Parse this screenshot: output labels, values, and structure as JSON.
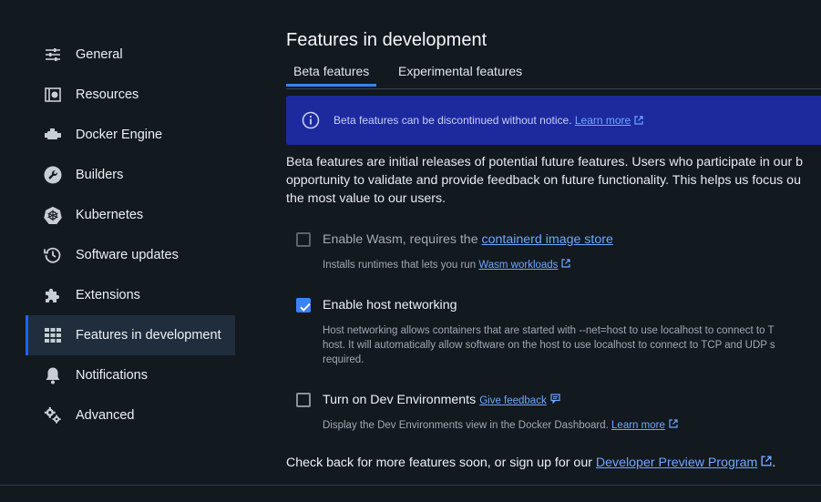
{
  "sidebar": {
    "items": [
      {
        "label": "General",
        "icon": "sliders-icon"
      },
      {
        "label": "Resources",
        "icon": "resources-icon"
      },
      {
        "label": "Docker Engine",
        "icon": "engine-icon"
      },
      {
        "label": "Builders",
        "icon": "wrench-icon"
      },
      {
        "label": "Kubernetes",
        "icon": "kubernetes-icon"
      },
      {
        "label": "Software updates",
        "icon": "history-icon"
      },
      {
        "label": "Extensions",
        "icon": "puzzle-icon"
      },
      {
        "label": "Features in development",
        "icon": "grid-icon",
        "active": true
      },
      {
        "label": "Notifications",
        "icon": "bell-icon"
      },
      {
        "label": "Advanced",
        "icon": "gears-icon"
      }
    ]
  },
  "main": {
    "title": "Features in development",
    "tabs": [
      {
        "label": "Beta features",
        "active": true
      },
      {
        "label": "Experimental features",
        "active": false
      }
    ],
    "banner": {
      "text": "Beta features can be discontinued without notice.",
      "link": "Learn more"
    },
    "description": [
      "Beta features are initial releases of potential future features. Users who participate in our b",
      "opportunity to validate and provide feedback on future functionality. This helps us focus ou",
      "the most value to our users."
    ],
    "features": [
      {
        "label": "Enable Wasm, requires the ",
        "label_link": "containerd image store",
        "checked": false,
        "disabled": true,
        "sub_text": "Installs runtimes that lets you run ",
        "sub_link": "Wasm workloads"
      },
      {
        "label": "Enable host networking",
        "checked": true,
        "disabled": false,
        "sub_lines": [
          "Host networking allows containers that are started with --net=host to use localhost to connect to T",
          "host. It will automatically allow software on the host to use localhost to connect to TCP and UDP s",
          "required."
        ]
      },
      {
        "label": "Turn on Dev Environments",
        "label_link": "Give feedback",
        "checked": false,
        "disabled": false,
        "sub_text": "Display the Dev Environments view in the Docker Dashboard. ",
        "sub_link": "Learn more"
      }
    ],
    "footer": {
      "text": "Check back for more features soon, or sign up for our ",
      "link": "Developer Preview Program",
      "suffix": "."
    }
  },
  "colors": {
    "background": "#12191f",
    "accent": "#3b82f6",
    "banner": "#1d2a9e",
    "active_nav": "#1f2d3d"
  }
}
